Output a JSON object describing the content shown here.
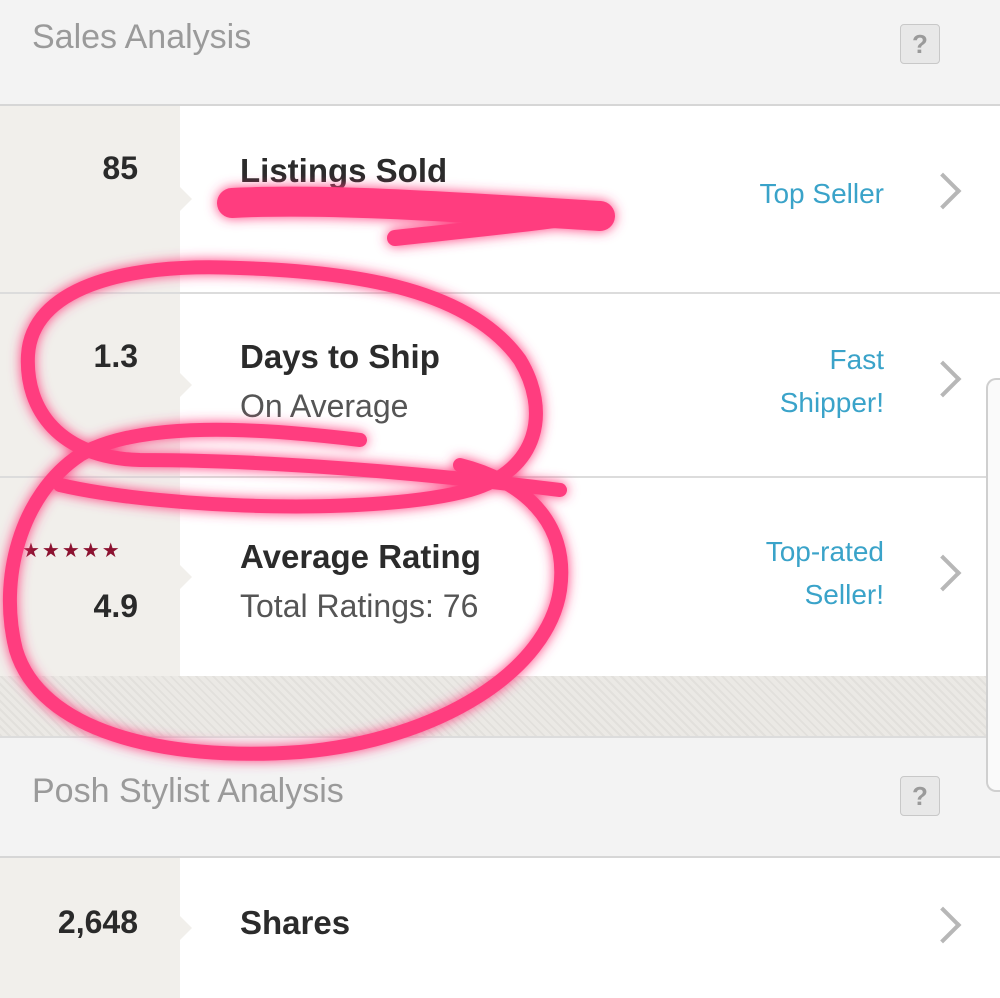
{
  "sales": {
    "title": "Sales Analysis",
    "help": "?",
    "rows": [
      {
        "metric": "85",
        "title": "Listings Sold",
        "subtitle": "",
        "badge": [
          "Top Seller"
        ]
      },
      {
        "metric": "1.3",
        "title": "Days to Ship",
        "subtitle": "On Average",
        "badge": [
          "Fast",
          "Shipper!"
        ]
      },
      {
        "metric": "4.9",
        "stars": "★★★★★",
        "title": "Average Rating",
        "subtitle": "Total Ratings: 76",
        "badge": [
          "Top-rated",
          "Seller!"
        ]
      }
    ]
  },
  "posh": {
    "title": "Posh Stylist Analysis",
    "help": "?",
    "rows": [
      {
        "metric": "2,648",
        "title": "Shares"
      }
    ]
  },
  "colors": {
    "badge_blue": "#3aa3c9",
    "annotation_pink": "#ff3d7f",
    "star_maroon": "#8c1230"
  },
  "icons": [
    "help-icon",
    "chevron-right-icon",
    "star-icon"
  ]
}
